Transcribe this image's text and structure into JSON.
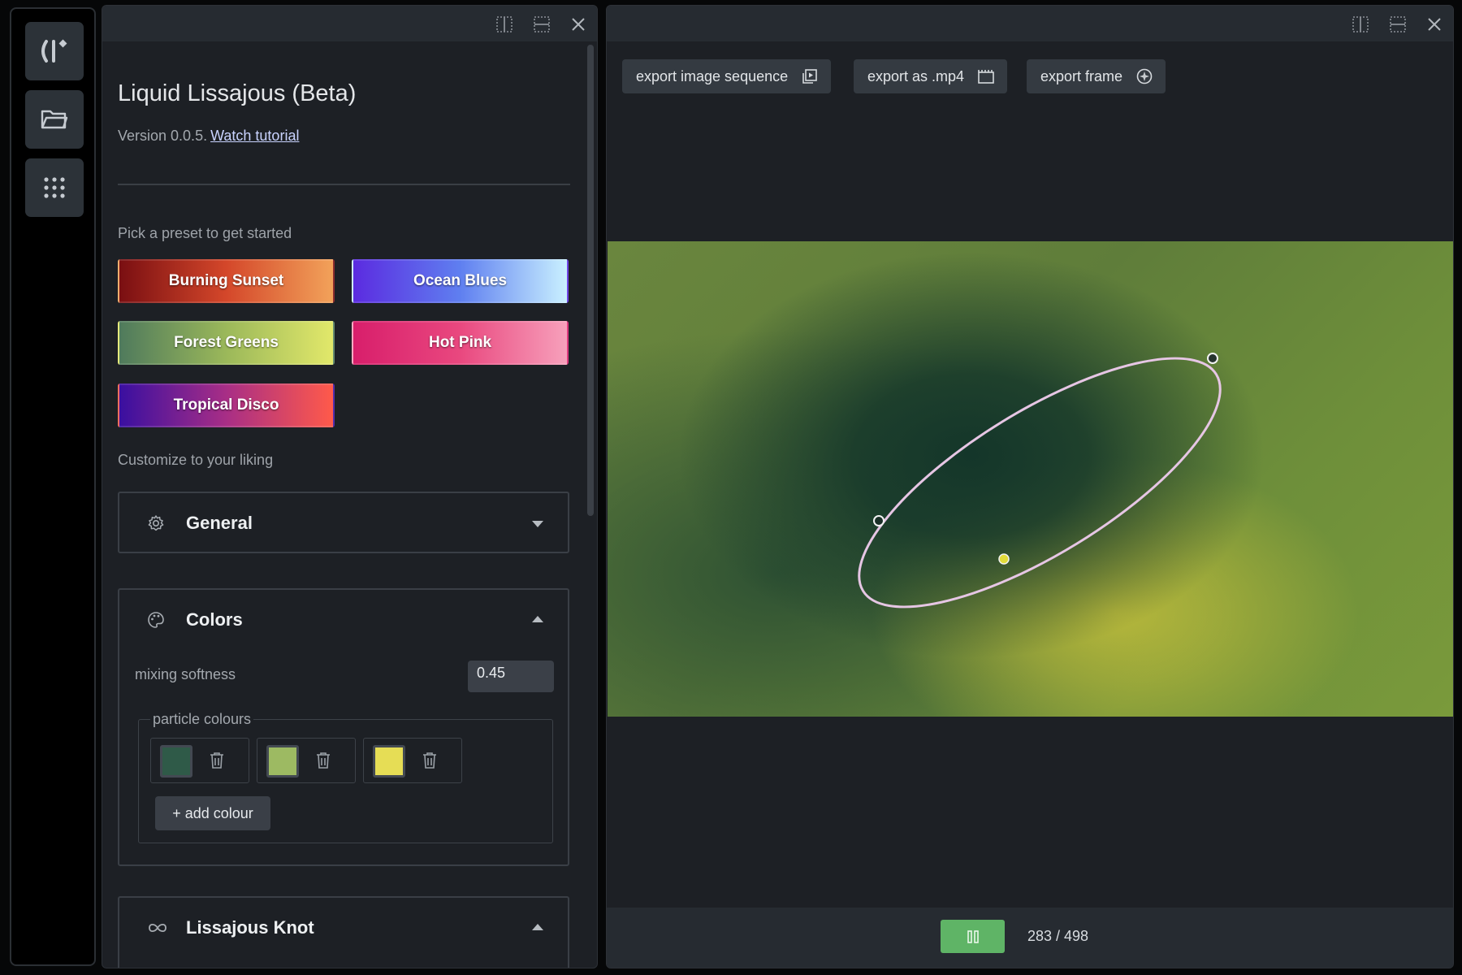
{
  "rail": {
    "buttons": [
      {
        "name": "logo-icon"
      },
      {
        "name": "folder-icon"
      },
      {
        "name": "apps-grid-icon"
      }
    ]
  },
  "sidebar": {
    "title": "Liquid Lissajous (Beta)",
    "version_text": "Version 0.0.5.",
    "tutorial_link": "Watch tutorial",
    "preset_prompt": "Pick a preset to get started",
    "presets": [
      {
        "label": "Burning Sunset",
        "colors": [
          "#7a0f12",
          "#d4472a",
          "#f2a25a"
        ]
      },
      {
        "label": "Ocean Blues",
        "colors": [
          "#5b2be0",
          "#5f7ff0",
          "#c9f0ff"
        ]
      },
      {
        "label": "Forest Greens",
        "colors": [
          "#4f7a5c",
          "#9bb85a",
          "#e2e86a"
        ]
      },
      {
        "label": "Hot Pink",
        "colors": [
          "#d81e6b",
          "#e9487f",
          "#f7a0bb"
        ]
      },
      {
        "label": "Tropical Disco",
        "colors": [
          "#3a0fa0",
          "#a82e86",
          "#ff5a4a"
        ]
      }
    ],
    "customize_prompt": "Customize to your liking",
    "general": {
      "title": "General",
      "icon": "gear-icon",
      "expanded": false
    },
    "colors": {
      "title": "Colors",
      "icon": "palette-icon",
      "expanded": true,
      "mixing_label": "mixing softness",
      "mixing_value": "0.45",
      "particle_legend": "particle colours",
      "particle_colours": [
        "#2f5a48",
        "#9dba62",
        "#e6dd55"
      ],
      "add_label": "+ add colour"
    },
    "lissajous": {
      "title": "Lissajous Knot",
      "icon": "infinity-icon",
      "expanded": true
    }
  },
  "viewer": {
    "toolbar": [
      {
        "label": "export image sequence",
        "icon": "image-sequence-icon"
      },
      {
        "label": "export as .mp4",
        "icon": "film-icon"
      },
      {
        "label": "export frame",
        "icon": "camera-aperture-icon"
      }
    ],
    "frame_counter": "283 / 498",
    "playing": true
  },
  "colors": {
    "panel_bg": "#1d2025",
    "header_bg": "#262b31",
    "play_green": "#5fb466",
    "curve": "#e6c6e4"
  }
}
